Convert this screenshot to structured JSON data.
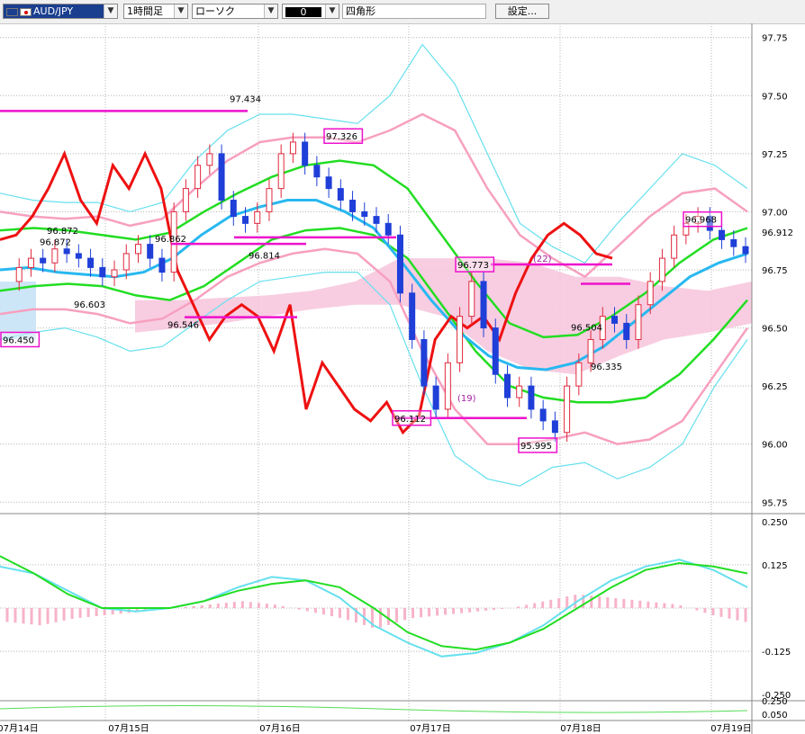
{
  "toolbar": {
    "symbol": "AUD/JPY",
    "timeframe": "1時間足",
    "chart_type": "ローソク",
    "color_sample": "0",
    "drawing_tool": "四角形",
    "settings_label": "設定..."
  },
  "colors": {
    "bull_candle": "#e0283c",
    "bear_candle": "#1f3fd8",
    "red_line": "#ee1111",
    "green_band": "#22dd22",
    "mid_line": "#28b8f0",
    "pink_band": "#f7a0c0",
    "cyan_band": "#66e0ee",
    "cloud": "#f7c4dc",
    "cloud_blue": "#cde6f7",
    "magenta": "#ee11cc",
    "macd_hist": "#f7b3c8",
    "grid": "#b4b4b4"
  },
  "chart_data": {
    "type": "candlestick",
    "symbol": "AUD/JPY",
    "timeframe": "1時間足",
    "x_labels": [
      "07月14日",
      "07月15日",
      "07月16日",
      "07月17日",
      "07月18日",
      "07月19日"
    ],
    "y_ticks": [
      "97.75",
      "97.50",
      "97.25",
      "97.00",
      "96.75",
      "96.50",
      "96.25",
      "96.00",
      "95.75"
    ],
    "ylim": [
      95.72,
      97.78
    ],
    "current_price": "96.912",
    "annotations": [
      {
        "text": "97.434",
        "value": 97.434,
        "boxed": false
      },
      {
        "text": "97.326",
        "value": 97.326,
        "boxed": true
      },
      {
        "text": "96.872",
        "value": 96.872,
        "boxed": false
      },
      {
        "text": "96.872",
        "value": 96.872,
        "boxed": false
      },
      {
        "text": "96.862",
        "value": 96.862,
        "boxed": false
      },
      {
        "text": "96.814",
        "value": 96.814,
        "boxed": false
      },
      {
        "text": "96.603",
        "value": 96.603,
        "boxed": false
      },
      {
        "text": "96.546",
        "value": 96.546,
        "boxed": false
      },
      {
        "text": "96.450",
        "value": 96.45,
        "boxed": true
      },
      {
        "text": "96.773",
        "value": 96.773,
        "boxed": true
      },
      {
        "text": "96.112",
        "value": 96.112,
        "boxed": true
      },
      {
        "text": "95.995",
        "value": 95.995,
        "boxed": true
      },
      {
        "text": "96.504",
        "value": 96.504,
        "boxed": false
      },
      {
        "text": "96.335",
        "value": 96.335,
        "boxed": false
      },
      {
        "text": "96.968",
        "value": 96.968,
        "boxed": true
      },
      {
        "text": "(22)",
        "value": 96.8,
        "boxed": false
      },
      {
        "text": "(19)",
        "value": 96.2,
        "boxed": false
      }
    ],
    "candle_keys": [
      96.7,
      96.76,
      96.8,
      96.78,
      96.84,
      96.82,
      96.8,
      96.76,
      96.72,
      96.75,
      96.82,
      96.86,
      96.8,
      96.74,
      97.0,
      97.1,
      97.2,
      97.25,
      97.05,
      96.98,
      96.95,
      97.0,
      97.1,
      97.25,
      97.3,
      97.2,
      97.15,
      97.1,
      97.05,
      97.0,
      96.98,
      96.95,
      96.9,
      96.65,
      96.45,
      96.25,
      96.15,
      96.35,
      96.55,
      96.7,
      96.5,
      96.3,
      96.2,
      96.25,
      96.15,
      96.1,
      96.05,
      96.25,
      96.35,
      96.45,
      96.55,
      96.52,
      96.45,
      96.6,
      96.7,
      96.8,
      96.9,
      96.95,
      96.98,
      96.92,
      96.88,
      96.85,
      96.82
    ],
    "red_line": [
      96.88,
      96.9,
      96.98,
      97.1,
      97.25,
      97.05,
      96.95,
      97.2,
      97.1,
      97.25,
      97.1,
      96.75,
      96.6,
      96.45,
      96.55,
      96.6,
      96.55,
      96.4,
      96.6,
      96.15,
      96.35,
      96.25,
      96.15,
      96.1,
      96.18,
      96.05,
      96.12,
      96.45,
      96.55,
      96.5,
      96.55,
      96.45,
      96.65,
      96.8,
      96.9,
      96.95,
      96.9,
      96.82,
      96.8
    ],
    "mid_line": [
      96.75,
      96.76,
      96.74,
      96.73,
      96.72,
      96.74,
      96.8,
      96.9,
      96.98,
      97.02,
      97.05,
      97.05,
      97.0,
      96.93,
      96.78,
      96.62,
      96.48,
      96.38,
      96.33,
      96.32,
      96.35,
      96.42,
      96.52,
      96.62,
      96.72,
      96.78,
      96.82
    ],
    "green_upper": [
      96.92,
      96.93,
      96.92,
      96.9,
      96.88,
      96.91,
      97.0,
      97.08,
      97.15,
      97.2,
      97.22,
      97.2,
      97.1,
      96.9,
      96.7,
      96.52,
      96.46,
      96.47,
      96.55,
      96.65,
      96.78,
      96.88,
      96.93
    ],
    "green_lower": [
      96.66,
      96.68,
      96.69,
      96.68,
      96.64,
      96.62,
      96.68,
      96.78,
      96.88,
      96.92,
      96.93,
      96.9,
      96.8,
      96.6,
      96.4,
      96.25,
      96.2,
      96.18,
      96.18,
      96.2,
      96.3,
      96.45,
      96.62
    ],
    "pink_upper": [
      97.0,
      96.98,
      96.97,
      96.98,
      96.94,
      96.97,
      97.1,
      97.22,
      97.3,
      97.32,
      97.32,
      97.3,
      97.35,
      97.42,
      97.35,
      97.1,
      96.9,
      96.8,
      96.72,
      96.85,
      96.98,
      97.08,
      97.1,
      97.0
    ],
    "pink_lower": [
      96.56,
      96.58,
      96.58,
      96.56,
      96.52,
      96.54,
      96.62,
      96.72,
      96.78,
      96.82,
      96.84,
      96.82,
      96.7,
      96.4,
      96.15,
      96.0,
      96.0,
      96.02,
      96.05,
      96.0,
      96.02,
      96.1,
      96.3,
      96.5
    ],
    "cyan_upper": [
      97.08,
      97.05,
      97.04,
      97.04,
      97.0,
      97.04,
      97.22,
      97.35,
      97.42,
      97.42,
      97.4,
      97.38,
      97.5,
      97.72,
      97.55,
      97.25,
      96.95,
      96.85,
      96.78,
      96.95,
      97.1,
      97.25,
      97.2,
      97.1
    ],
    "cyan_lower": [
      96.45,
      96.48,
      96.5,
      96.46,
      96.4,
      96.42,
      96.52,
      96.62,
      96.7,
      96.72,
      96.74,
      96.74,
      96.6,
      96.25,
      95.95,
      95.85,
      95.82,
      95.9,
      95.92,
      95.85,
      95.9,
      96.0,
      96.25,
      96.45
    ],
    "cloud_top": [
      96.62,
      96.62,
      96.63,
      96.64,
      96.66,
      96.7,
      96.8,
      96.8,
      96.8,
      96.78,
      96.72,
      96.72,
      96.68,
      96.66,
      96.7
    ],
    "cloud_bottom": [
      96.48,
      96.5,
      96.52,
      96.55,
      96.58,
      96.6,
      96.6,
      96.55,
      96.4,
      96.32,
      96.3,
      96.38,
      96.45,
      96.48,
      96.52
    ],
    "macd": {
      "y_ticks": [
        "0.250",
        "0.125",
        "-0.125",
        "-0.250"
      ],
      "ylim": [
        -0.26,
        0.26
      ],
      "macd_line": [
        0.12,
        0.1,
        0.05,
        0.0,
        -0.01,
        0.0,
        0.02,
        0.06,
        0.09,
        0.08,
        0.03,
        -0.05,
        -0.1,
        -0.14,
        -0.13,
        -0.1,
        -0.05,
        0.02,
        0.08,
        0.12,
        0.14,
        0.11,
        0.06
      ],
      "signal_line": [
        0.15,
        0.1,
        0.04,
        0.0,
        0.0,
        0.0,
        0.02,
        0.05,
        0.07,
        0.08,
        0.06,
        0.0,
        -0.07,
        -0.11,
        -0.12,
        -0.1,
        -0.06,
        0.0,
        0.06,
        0.11,
        0.13,
        0.12,
        0.1
      ],
      "histogram": [
        -0.04,
        -0.05,
        -0.03,
        -0.02,
        -0.01,
        0.0,
        0.01,
        0.02,
        0.01,
        -0.01,
        -0.03,
        -0.06,
        -0.03,
        -0.02,
        -0.01,
        0.0,
        0.02,
        0.04,
        0.03,
        0.02,
        0.01,
        -0.02,
        -0.04
      ]
    },
    "third_pane": {
      "y_ticks": [
        "0.250",
        "0.050"
      ]
    }
  }
}
